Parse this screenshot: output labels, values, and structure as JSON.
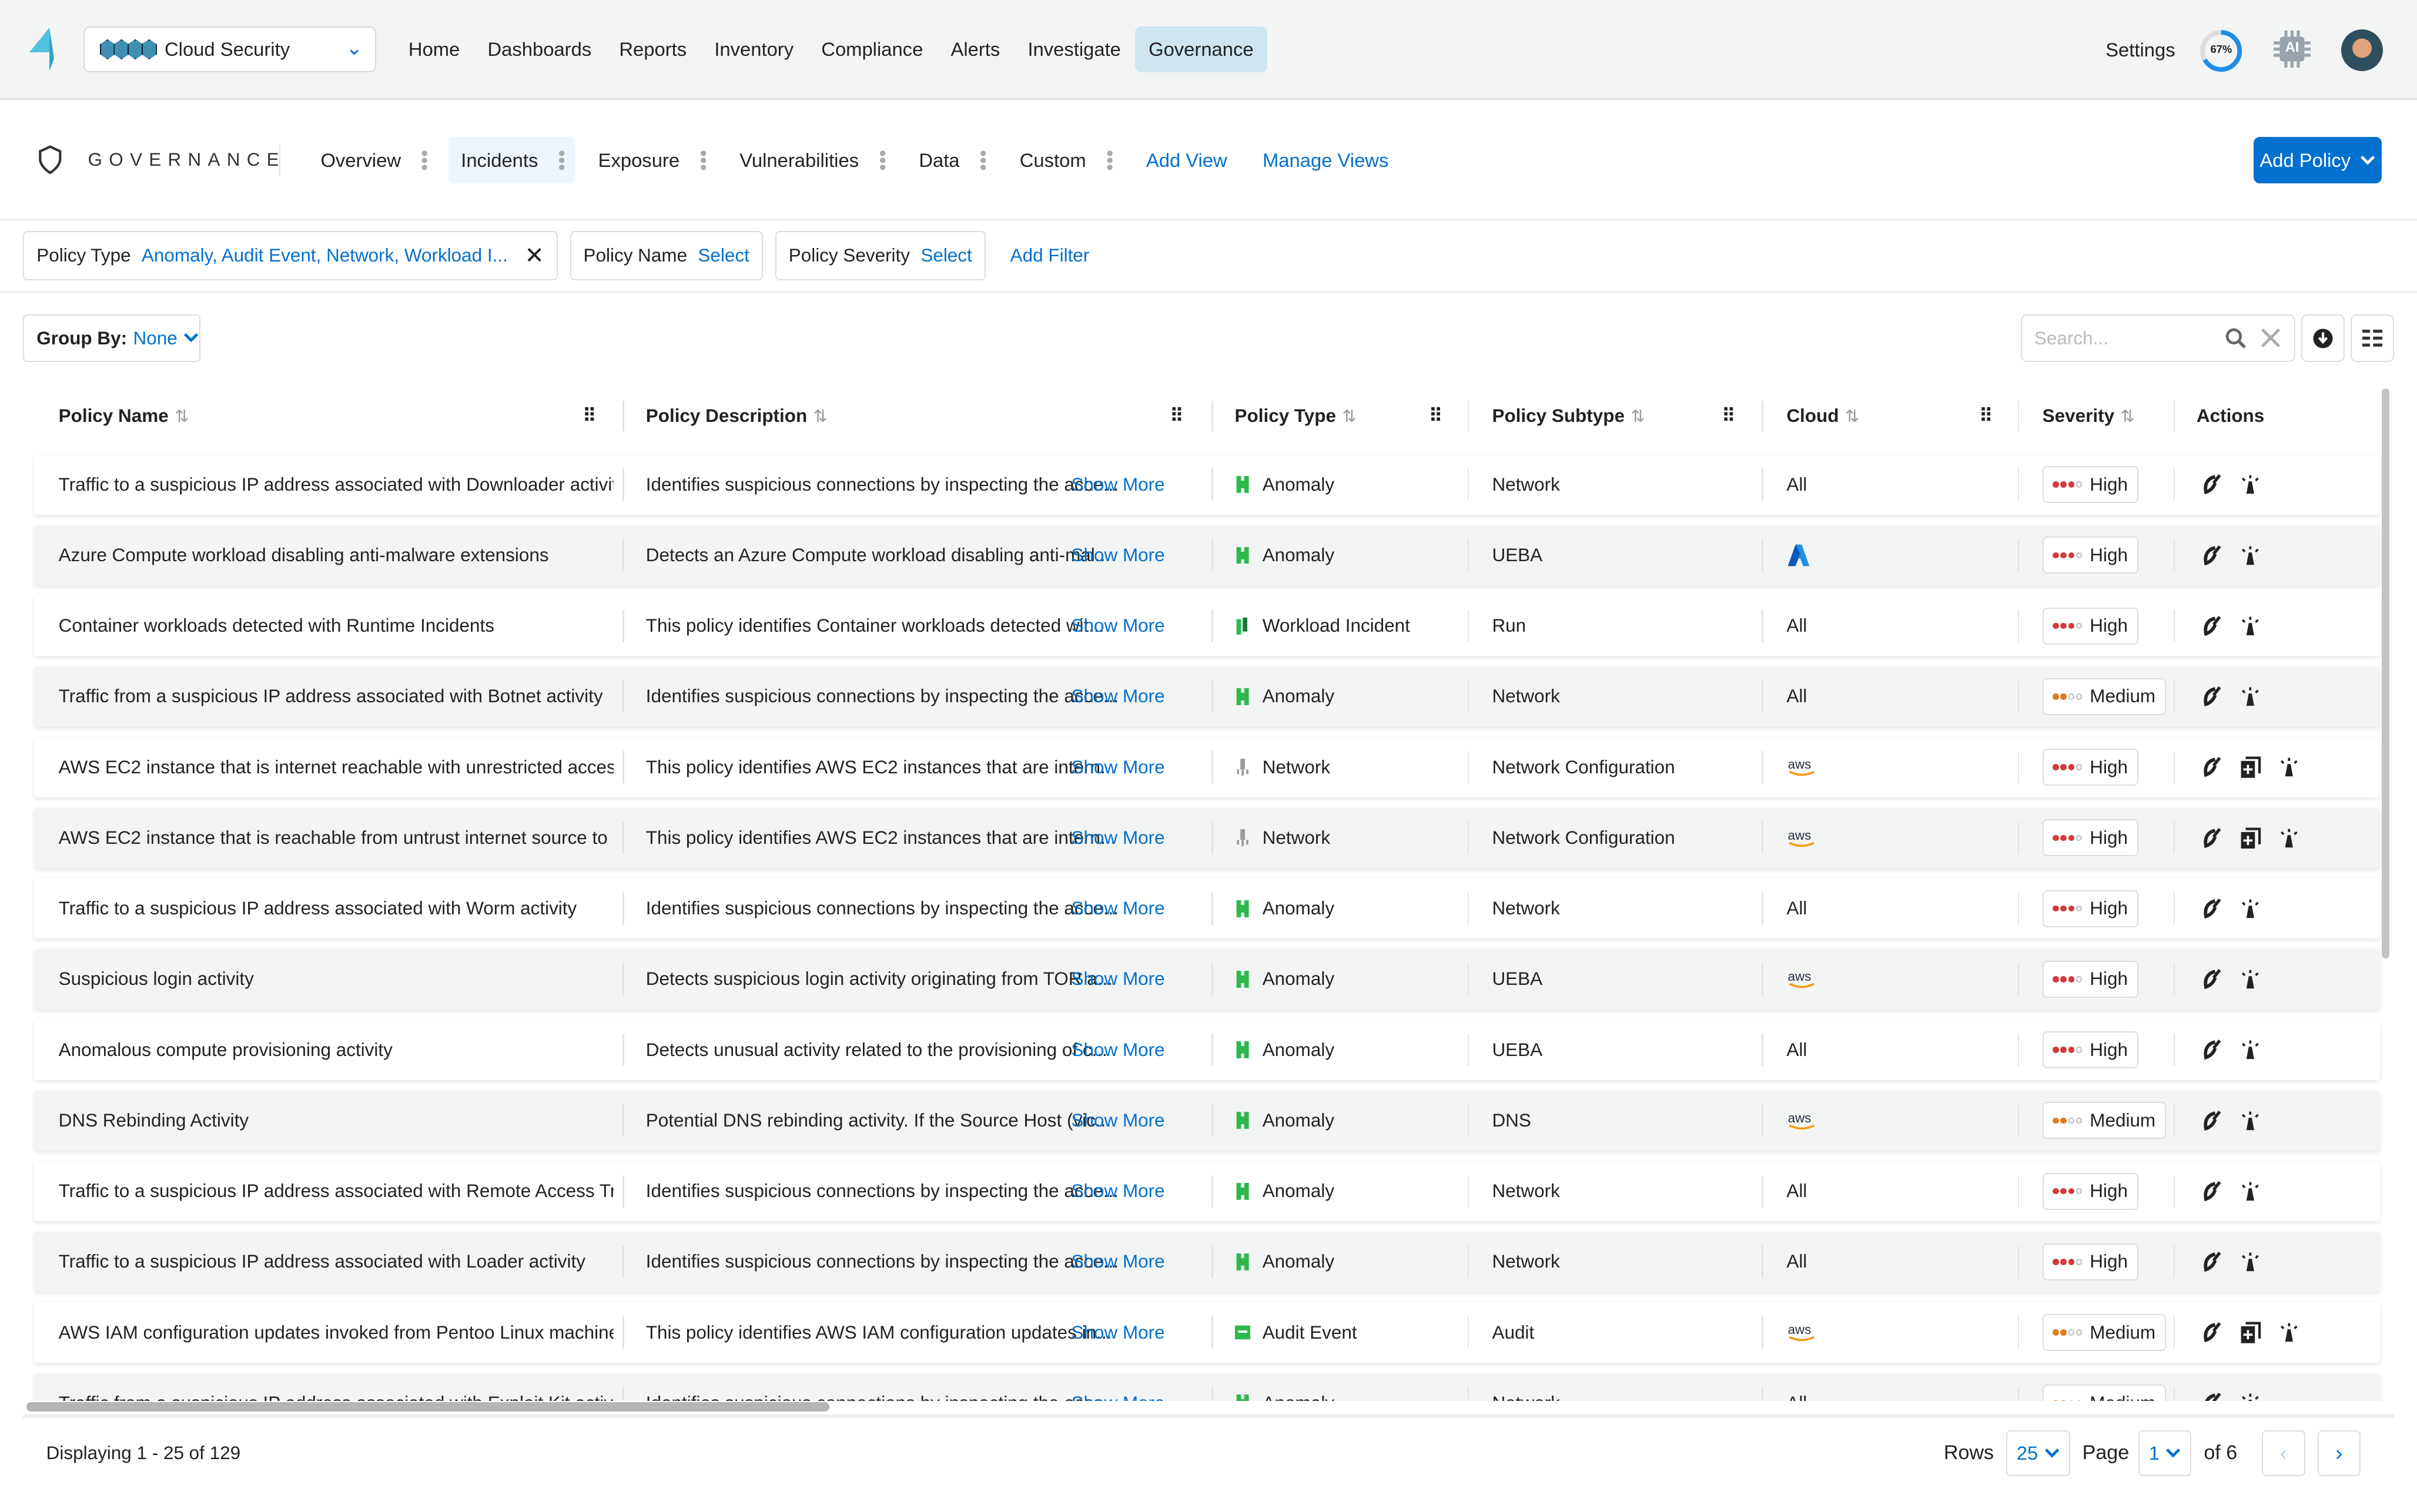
{
  "topbar": {
    "product": "Cloud Security",
    "nav": [
      "Home",
      "Dashboards",
      "Reports",
      "Inventory",
      "Compliance",
      "Alerts",
      "Investigate",
      "Governance"
    ],
    "active_nav": "Governance",
    "settings": "Settings",
    "progress_label": "67%",
    "progress_value": 0.67,
    "ai_label": "AI"
  },
  "subheader": {
    "title": "GOVERNANCE",
    "tabs": [
      "Overview",
      "Incidents",
      "Exposure",
      "Vulnerabilities",
      "Data",
      "Custom"
    ],
    "active_tab": "Incidents",
    "add_view": "Add View",
    "manage_views": "Manage Views",
    "add_policy": "Add Policy"
  },
  "filters": {
    "policy_type_label": "Policy Type",
    "policy_type_value": "Anomaly, Audit Event, Network, Workload I...",
    "policy_name_label": "Policy Name",
    "policy_name_value": "Select",
    "policy_severity_label": "Policy Severity",
    "policy_severity_value": "Select",
    "add_filter": "Add Filter"
  },
  "toolbar": {
    "group_by_label": "Group By:",
    "group_by_value": "None",
    "search_placeholder": "Search..."
  },
  "table": {
    "columns": [
      "Policy Name",
      "Policy Description",
      "Policy Type",
      "Policy Subtype",
      "Cloud",
      "Severity",
      "Actions"
    ],
    "show_more": "Show More",
    "colors": {
      "high": "#d13b3b",
      "medium": "#e07a1f",
      "anomaly": "#2db84d",
      "network": "#9a9a9a",
      "link": "#0170ce"
    },
    "rows": [
      {
        "name": "Traffic to a suspicious IP address associated with Downloader activity",
        "desc": "Identifies suspicious connections by inspecting the acce...",
        "type": "Anomaly",
        "subtype": "Network",
        "cloud": "All",
        "severity": "High",
        "actions": [
          "edit-icon",
          "alarm-icon"
        ]
      },
      {
        "name": "Azure Compute workload disabling anti-malware extensions",
        "desc": "Detects an Azure Compute workload disabling anti-mal...",
        "type": "Anomaly",
        "subtype": "UEBA",
        "cloud": "azure",
        "severity": "High",
        "actions": [
          "edit-icon",
          "alarm-icon"
        ]
      },
      {
        "name": "Container workloads detected with Runtime Incidents",
        "desc": "This policy identifies Container workloads detected wit...",
        "type": "Workload Incident",
        "subtype": "Run",
        "cloud": "All",
        "severity": "High",
        "actions": [
          "edit-icon",
          "alarm-icon"
        ]
      },
      {
        "name": "Traffic from a suspicious IP address associated with Botnet activity",
        "desc": "Identifies suspicious connections by inspecting the acce...",
        "type": "Anomaly",
        "subtype": "Network",
        "cloud": "All",
        "severity": "Medium",
        "actions": [
          "edit-icon",
          "alarm-icon"
        ]
      },
      {
        "name": "AWS EC2 instance that is internet reachable with unrestricted acces...",
        "desc": "This policy identifies AWS EC2 instances that are intern...",
        "type": "Network",
        "subtype": "Network Configuration",
        "cloud": "aws",
        "severity": "High",
        "actions": [
          "edit-icon",
          "add-compliance-icon",
          "alarm-icon"
        ]
      },
      {
        "name": "AWS EC2 instance that is reachable from untrust internet source to ...",
        "desc": "This policy identifies AWS EC2 instances that are intern...",
        "type": "Network",
        "subtype": "Network Configuration",
        "cloud": "aws",
        "severity": "High",
        "actions": [
          "edit-icon",
          "add-compliance-icon",
          "alarm-icon"
        ]
      },
      {
        "name": "Traffic to a suspicious IP address associated with Worm activity",
        "desc": "Identifies suspicious connections by inspecting the acce...",
        "type": "Anomaly",
        "subtype": "Network",
        "cloud": "All",
        "severity": "High",
        "actions": [
          "edit-icon",
          "alarm-icon"
        ]
      },
      {
        "name": "Suspicious login activity",
        "desc": "Detects suspicious login activity originating from TOR a...",
        "type": "Anomaly",
        "subtype": "UEBA",
        "cloud": "aws",
        "severity": "High",
        "actions": [
          "edit-icon",
          "alarm-icon"
        ]
      },
      {
        "name": "Anomalous compute provisioning activity",
        "desc": "Detects unusual activity related to the provisioning of c...",
        "type": "Anomaly",
        "subtype": "UEBA",
        "cloud": "All",
        "severity": "High",
        "actions": [
          "edit-icon",
          "alarm-icon"
        ]
      },
      {
        "name": "DNS Rebinding Activity",
        "desc": "Potential DNS rebinding activity. If the Source Host (vic...",
        "type": "Anomaly",
        "subtype": "DNS",
        "cloud": "aws",
        "severity": "Medium",
        "actions": [
          "edit-icon",
          "alarm-icon"
        ]
      },
      {
        "name": "Traffic to a suspicious IP address associated with Remote Access Troj...",
        "desc": "Identifies suspicious connections by inspecting the acce...",
        "type": "Anomaly",
        "subtype": "Network",
        "cloud": "All",
        "severity": "High",
        "actions": [
          "edit-icon",
          "alarm-icon"
        ]
      },
      {
        "name": "Traffic to a suspicious IP address associated with Loader activity",
        "desc": "Identifies suspicious connections by inspecting the acce...",
        "type": "Anomaly",
        "subtype": "Network",
        "cloud": "All",
        "severity": "High",
        "actions": [
          "edit-icon",
          "alarm-icon"
        ]
      },
      {
        "name": "AWS IAM configuration updates invoked from Pentoo Linux machine",
        "desc": "This policy identifies AWS IAM configuration updates in...",
        "type": "Audit Event",
        "subtype": "Audit",
        "cloud": "aws",
        "severity": "Medium",
        "actions": [
          "edit-icon",
          "add-compliance-icon",
          "alarm-icon"
        ]
      },
      {
        "name": "Traffic from a suspicious IP address associated with Exploit Kit activity",
        "desc": "Identifies suspicious connections by inspecting the acce...",
        "type": "Anomaly",
        "subtype": "Network",
        "cloud": "All",
        "severity": "Medium",
        "actions": [
          "edit-icon",
          "alarm-icon"
        ]
      }
    ]
  },
  "footer": {
    "displaying": "Displaying 1 - 25 of 129",
    "rows_label": "Rows",
    "rows_value": "25",
    "page_label": "Page",
    "page_value": "1",
    "of_pages": "of 6"
  }
}
